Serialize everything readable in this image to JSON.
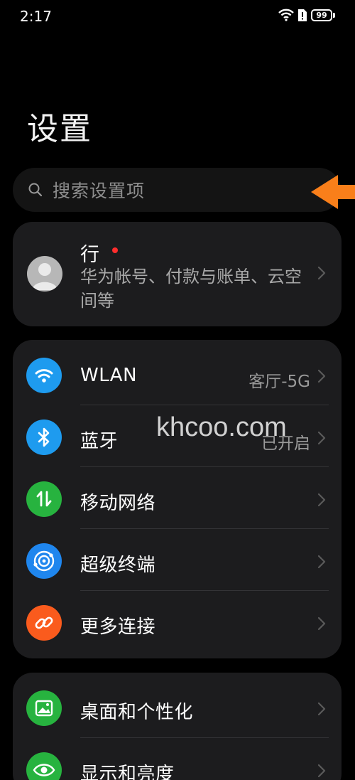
{
  "status": {
    "time": "2:17",
    "battery": "99"
  },
  "page": {
    "title": "设置"
  },
  "search": {
    "placeholder": "搜索设置项"
  },
  "account": {
    "name": "行",
    "subtitle": "华为帐号、付款与账单、云空间等"
  },
  "connectivity": [
    {
      "label": "WLAN",
      "value": "客厅-5G",
      "icon": "wifi-icon",
      "color": "#1e9bef"
    },
    {
      "label": "蓝牙",
      "value": "已开启",
      "icon": "bluetooth-icon",
      "color": "#1e9bef"
    },
    {
      "label": "移动网络",
      "value": "",
      "icon": "mobile-data-icon",
      "color": "#27b33f"
    },
    {
      "label": "超级终端",
      "value": "",
      "icon": "super-device-icon",
      "color": "#1f86ee"
    },
    {
      "label": "更多连接",
      "value": "",
      "icon": "link-icon",
      "color": "#fa5b1d"
    }
  ],
  "display": [
    {
      "label": "桌面和个性化",
      "icon": "wallpaper-icon",
      "color": "#27b33f"
    },
    {
      "label": "显示和亮度",
      "icon": "eye-icon",
      "color": "#27b33f"
    }
  ],
  "watermark": "khcoo.com",
  "colors": {
    "background": "#000000",
    "card": "#1c1c1e",
    "annotation_arrow": "#f97f1a",
    "notification_dot": "#ff2d2d"
  }
}
